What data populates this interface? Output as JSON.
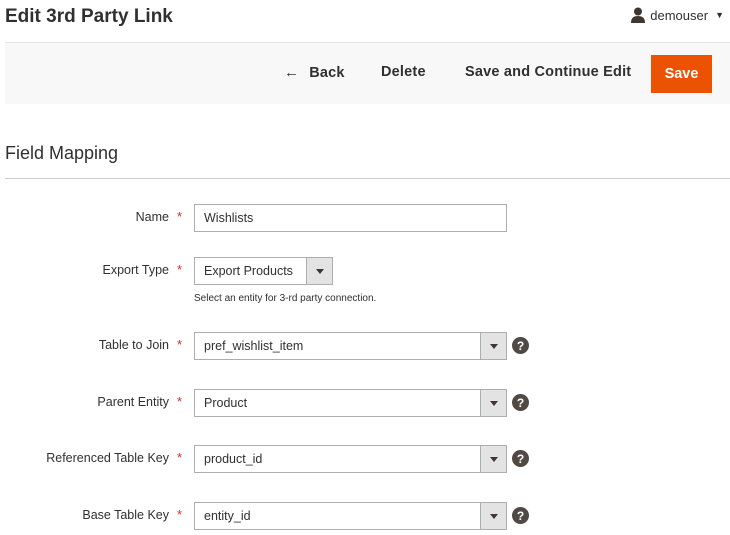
{
  "header": {
    "title": "Edit 3rd Party Link",
    "user": {
      "name": "demouser",
      "icon": "user-icon",
      "caret_icon": "caret-down-icon"
    }
  },
  "actions": {
    "back_label": "Back",
    "delete_label": "Delete",
    "save_continue_label": "Save and Continue Edit",
    "save_label": "Save",
    "save_color": "#eb5202"
  },
  "section": {
    "title": "Field Mapping"
  },
  "form": {
    "required_mark": "*",
    "name": {
      "label": "Name",
      "value": "Wishlists"
    },
    "export_type": {
      "label": "Export Type",
      "value": "Export Products",
      "note": "Select an entity for 3-rd party connection."
    },
    "table_to_join": {
      "label": "Table to Join",
      "value": "pref_wishlist_item",
      "help": "?"
    },
    "parent_entity": {
      "label": "Parent Entity",
      "value": "Product",
      "help": "?"
    },
    "referenced_table_key": {
      "label": "Referenced Table Key",
      "value": "product_id",
      "help": "?"
    },
    "base_table_key": {
      "label": "Base Table Key",
      "value": "entity_id",
      "help": "?"
    }
  }
}
